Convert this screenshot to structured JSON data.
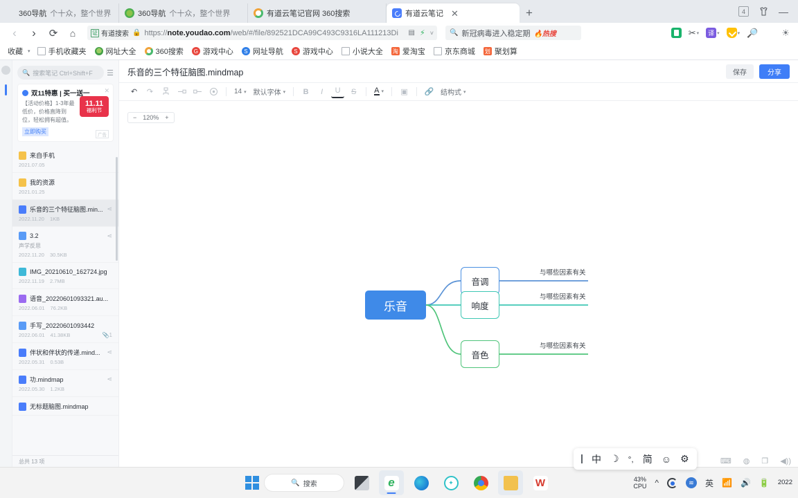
{
  "browser": {
    "tabs": [
      {
        "title": "360导航",
        "subtitle": "个十众，整个世界",
        "favicon": "none",
        "active": false
      },
      {
        "title": "360导航",
        "subtitle": "个十众，整个世界",
        "favicon": "360-leaf-icon",
        "active": false
      },
      {
        "title": "有道云笔记官网 360搜索",
        "subtitle": "",
        "favicon": "360-search-icon",
        "active": false
      },
      {
        "title": "有道云笔记",
        "subtitle": "",
        "favicon": "youdao-note-icon",
        "active": true
      }
    ],
    "new_tab_label": "+",
    "window_controls": {
      "count_badge": "4",
      "skin_label": "skin-icon",
      "minimize_label": "—"
    },
    "nav": {
      "back": "‹",
      "forward": "›",
      "reload": "⟳",
      "home": "⌂"
    },
    "omnibox": {
      "chip_label": "有道搜索",
      "chip_icon": "verified-icon",
      "url_prefix": "https://",
      "url_host": "note.youdao.com",
      "url_path": "/web/#/file/892521DCA99C493C9316LA111213Di",
      "lock_icon": "lock-icon"
    },
    "search": {
      "placeholder": "新冠病毒进入稳定期",
      "value": "新冠病毒进入稳定期",
      "hot_tag": "热搜",
      "icon": "search-icon"
    },
    "toolbar_icons": [
      "notes-icon",
      "scissors-icon",
      "translate-icon",
      "shield-icon",
      "magnifier-icon",
      "apps-grid-icon",
      "theme-icon"
    ],
    "bookmarks": [
      {
        "label": "收藏",
        "icon": "star-icon"
      },
      {
        "label": "手机收藏夹",
        "icon": "doc-icon"
      },
      {
        "label": "网址大全",
        "icon": "green-icon"
      },
      {
        "label": "360搜索",
        "icon": "ring-icon"
      },
      {
        "label": "游戏中心",
        "icon": "red-icon"
      },
      {
        "label": "网址导航",
        "icon": "blue-icon"
      },
      {
        "label": "游戏中心",
        "icon": "red-icon"
      },
      {
        "label": "小说大全",
        "icon": "doc-icon"
      },
      {
        "label": "爱淘宝",
        "icon": "orange-icon"
      },
      {
        "label": "京东商城",
        "icon": "doc-icon"
      },
      {
        "label": "聚划算",
        "icon": "orange-icon"
      }
    ]
  },
  "sidebar": {
    "search_placeholder": "搜索笔记 Ctrl+Shift+F",
    "search_icon": "search-icon",
    "view_toggle_icon": "list-view-icon",
    "promo": {
      "title": "双11特惠 | 买一送一",
      "body": "【活动价格】1-3年最低价，价格直降到位，轻松拥有超值。",
      "cta": "立即购买",
      "badge_top": "11.11",
      "badge_bottom": "福利节",
      "ad_mark": "广告",
      "close_icon": "close-icon"
    },
    "files": [
      {
        "name": "来自手机",
        "icon": "folder-icon",
        "date": "2021.07.05",
        "size": "",
        "snippet": "",
        "share": false,
        "selected": false
      },
      {
        "name": "我的资源",
        "icon": "folder-icon",
        "date": "2021.01.25",
        "size": "",
        "snippet": "",
        "share": false,
        "selected": false
      },
      {
        "name": "乐音的三个特征脑图.min...",
        "icon": "mindmap-icon",
        "date": "2022.11.20",
        "size": "1KB",
        "snippet": "",
        "share": true,
        "selected": true
      },
      {
        "name": "3.2",
        "icon": "doc-icon",
        "date": "2022.11.20",
        "size": "30.5KB",
        "snippet": "声学反思",
        "share": true,
        "selected": false
      },
      {
        "name": "IMG_20210610_162724.jpg",
        "icon": "image-icon",
        "date": "2022.11.19",
        "size": "2.7MB",
        "snippet": "",
        "share": false,
        "selected": false
      },
      {
        "name": "语音_20220601093321.au...",
        "icon": "audio-icon",
        "date": "2022.06.01",
        "size": "76.2KB",
        "snippet": "",
        "share": false,
        "selected": false
      },
      {
        "name": "手写_20220601093442",
        "icon": "doc-icon",
        "date": "2022.06.01",
        "size": "41.38KB",
        "snippet": "",
        "share": false,
        "clip": "1",
        "selected": false
      },
      {
        "name": "伴状和伴状的传递.mind...",
        "icon": "mindmap-icon",
        "date": "2022.05.31",
        "size": "0.53B",
        "snippet": "",
        "share": true,
        "selected": false
      },
      {
        "name": "功.mindmap",
        "icon": "mindmap-icon",
        "date": "2022.05.30",
        "size": "1.2KB",
        "snippet": "",
        "share": true,
        "selected": false
      },
      {
        "name": "无标题脑图.mindmap",
        "icon": "mindmap-icon",
        "date": "",
        "size": "",
        "snippet": "",
        "share": false,
        "selected": false
      }
    ],
    "footer": "总共 13 项"
  },
  "editor": {
    "title": "乐音的三个特征脑图.mindmap",
    "save_label": "保存",
    "share_label": "分享",
    "toolbar": {
      "undo_icon": "undo-icon",
      "redo_icon": "redo-icon",
      "add_sibling_icon": "add-sibling-node-icon",
      "add_child_icon": "add-child-node-icon",
      "add_parent_icon": "add-parent-node-icon",
      "locate_icon": "locate-icon",
      "font_size": "14",
      "font_family": "默认字体",
      "bold_icon": "bold-icon",
      "italic_icon": "italic-icon",
      "underline_icon": "underline-icon",
      "strike_icon": "strikethrough-icon",
      "text_color_icon": "text-color-icon",
      "fill_icon": "fill-color-icon",
      "link_icon": "link-icon",
      "structure_label": "结构式"
    },
    "zoom": {
      "minus": "−",
      "value": "120%",
      "plus": "+"
    }
  },
  "mindmap": {
    "root": {
      "label": "乐音",
      "color": "#3f8ae8"
    },
    "children": [
      {
        "label": "音调",
        "border": "#4a90e2",
        "leaf": "与哪些因素有关"
      },
      {
        "label": "响度",
        "border": "#3fc7b4",
        "leaf": "与哪些因素有关"
      },
      {
        "label": "音色",
        "border": "#4fc47a",
        "leaf": "与哪些因素有关"
      }
    ]
  },
  "ime": {
    "cursor_icon": "text-cursor-icon",
    "mode": "中",
    "moon_icon": "moon-icon",
    "punctuation": "°,",
    "simplified": "简",
    "emoji_icon": "emoji-icon",
    "settings_icon": "gear-icon"
  },
  "status_icons": [
    "keyboard-icon",
    "palette-icon",
    "window-icon",
    "volume-icon"
  ],
  "taskbar": {
    "start_icon": "windows-start-icon",
    "search_label": "搜索",
    "search_icon": "search-icon",
    "apps": [
      {
        "name": "task-view",
        "icon": "task-view-icon",
        "active": false
      },
      {
        "name": "360-browser",
        "icon": "ie-browser-icon",
        "active": true
      },
      {
        "name": "edge",
        "icon": "edge-icon",
        "active": false
      },
      {
        "name": "360-safe",
        "icon": "360-safe-icon",
        "active": false
      },
      {
        "name": "chrome",
        "icon": "chrome-icon",
        "active": false
      },
      {
        "name": "file-explorer",
        "icon": "folder-icon",
        "active": true
      },
      {
        "name": "wps-office",
        "icon": "wps-icon",
        "active": false
      }
    ],
    "tray": {
      "cpu_value": "43%",
      "cpu_label": "CPU",
      "chevron": "^",
      "sync_icon": "sync-icon",
      "app_360_icon": "360-tray-icon",
      "input_lang": "英",
      "wifi_icon": "wifi-icon",
      "volume_icon": "volume-icon",
      "battery_icon": "battery-icon",
      "date": "2022"
    }
  }
}
